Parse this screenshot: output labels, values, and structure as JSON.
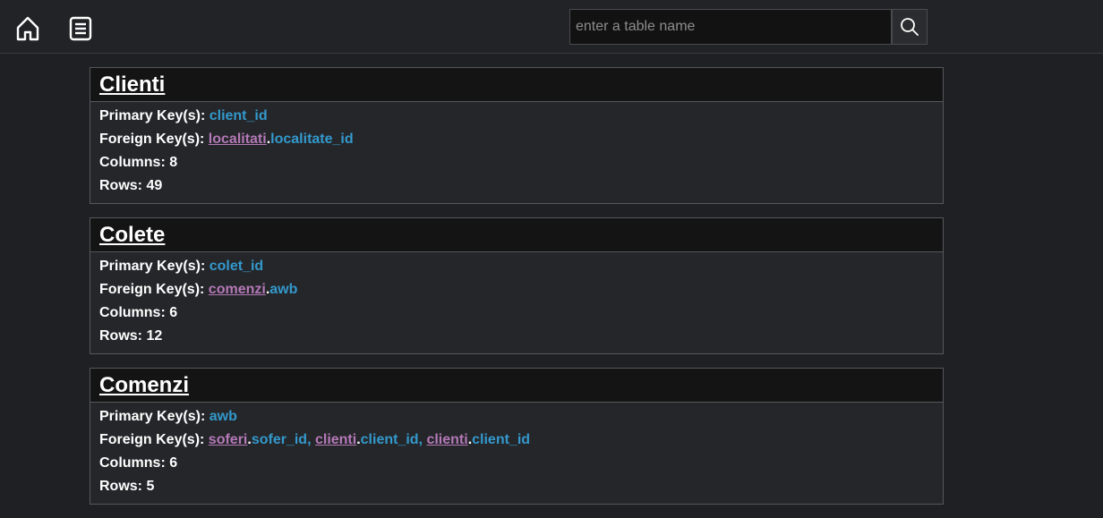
{
  "search": {
    "placeholder": "enter a table name"
  },
  "labels": {
    "primary_keys": "Primary Key(s): ",
    "foreign_keys": "Foreign Key(s): ",
    "columns": "Columns: ",
    "rows": "Rows: "
  },
  "tables": [
    {
      "name": "Clienti",
      "primary_key": "client_id",
      "foreign_keys": [
        {
          "table": "localitati",
          "column": "localitate_id",
          "sep": ""
        }
      ],
      "columns": "8",
      "rows": "49"
    },
    {
      "name": "Colete",
      "primary_key": "colet_id",
      "foreign_keys": [
        {
          "table": "comenzi",
          "column": "awb",
          "sep": ""
        }
      ],
      "columns": "6",
      "rows": "12"
    },
    {
      "name": "Comenzi",
      "primary_key": "awb",
      "foreign_keys": [
        {
          "table": "soferi",
          "column": "sofer_id",
          "sep": ", "
        },
        {
          "table": "clienti",
          "column": "client_id",
          "sep": ", "
        },
        {
          "table": "clienti",
          "column": "client_id",
          "sep": ""
        }
      ],
      "columns": "6",
      "rows": "5"
    }
  ]
}
